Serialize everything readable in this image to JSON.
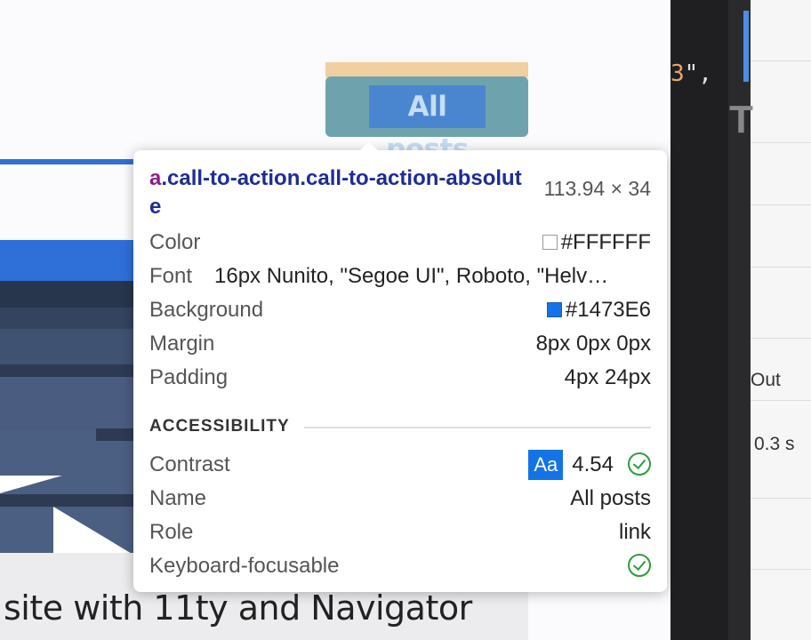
{
  "page": {
    "cta_label": "All posts",
    "caption": "site with 11ty and Navigator"
  },
  "devtools": {
    "code_fragment": "3",
    "code_quote_comma": "\",",
    "big_letter": "T",
    "out_label": "Out",
    "duration": "0.3 s"
  },
  "tooltip": {
    "tag": "a",
    "classes": ".call-to-action.call-to-action-absolute",
    "size": "113.94 × 34",
    "color_label": "Color",
    "color_value": "#FFFFFF",
    "font_label": "Font",
    "font_value": "16px Nunito, \"Segoe UI\", Roboto, \"Helv…",
    "background_label": "Background",
    "background_value": "#1473E6",
    "margin_label": "Margin",
    "margin_value": "8px 0px 0px",
    "padding_label": "Padding",
    "padding_value": "4px 24px",
    "accessibility_heading": "ACCESSIBILITY",
    "contrast_label": "Contrast",
    "contrast_badge": "Aa",
    "contrast_value": "4.54",
    "name_label": "Name",
    "name_value": "All posts",
    "role_label": "Role",
    "role_value": "link",
    "keyboard_label": "Keyboard-focusable"
  },
  "colors": {
    "selector_tag": "#8a1e86",
    "selector_class": "#1c2d95",
    "accent_blue": "#1473e6",
    "check_green": "#2e9c3c"
  }
}
